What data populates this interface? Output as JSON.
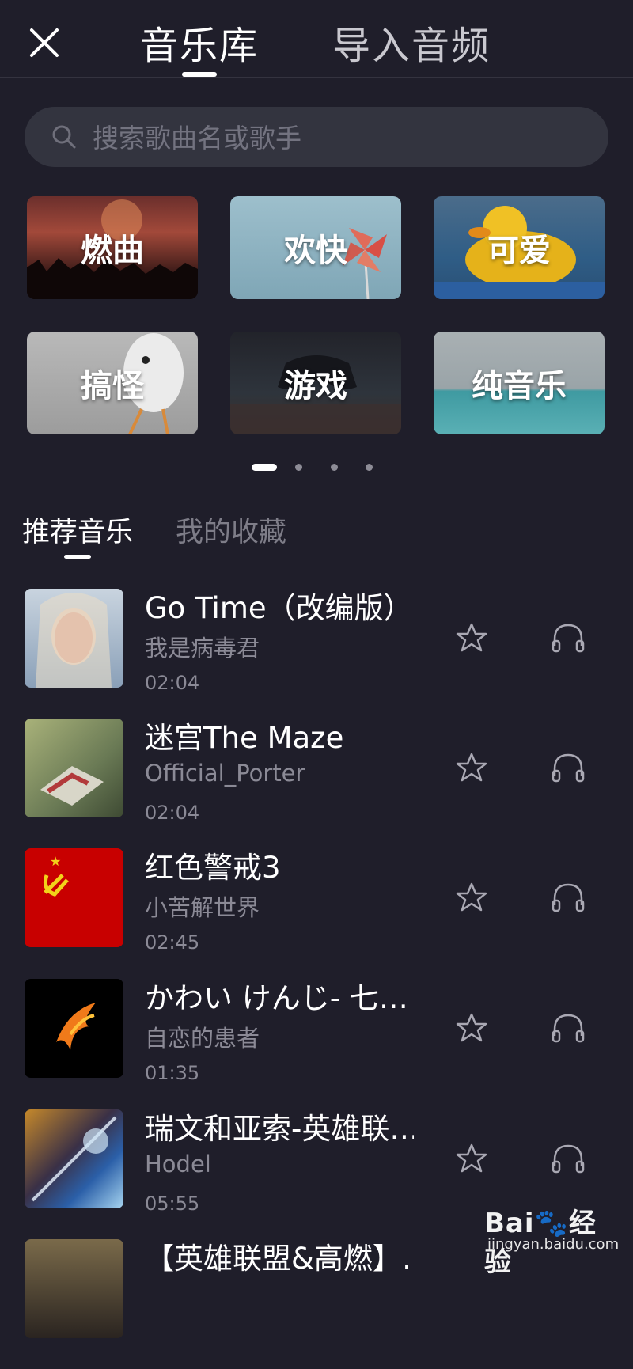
{
  "header": {
    "tabs": [
      {
        "label": "音乐库",
        "active": true
      },
      {
        "label": "导入音频",
        "active": false
      }
    ],
    "close_icon": "close-icon"
  },
  "search": {
    "placeholder": "搜索歌曲名或歌手",
    "value": "",
    "icon": "search-icon"
  },
  "categories": [
    {
      "label": "燃曲"
    },
    {
      "label": "欢快"
    },
    {
      "label": "可爱"
    },
    {
      "label": "搞怪"
    },
    {
      "label": "游戏"
    },
    {
      "label": "纯音乐"
    }
  ],
  "pager": {
    "pages": 4,
    "current": 1
  },
  "subtabs": [
    {
      "label": "推荐音乐",
      "active": true
    },
    {
      "label": "我的收藏",
      "active": false
    }
  ],
  "songs": [
    {
      "title": "Go Time（改编版）",
      "artist": "我是病毒君",
      "duration": "02:04"
    },
    {
      "title": "迷宫The Maze",
      "artist": "Official_Porter",
      "duration": "02:04"
    },
    {
      "title": "红色警戒3",
      "artist": "小苦解世界",
      "duration": "02:45"
    },
    {
      "title": "かわい けんじ- 七…",
      "artist": "自恋的患者",
      "duration": "01:35"
    },
    {
      "title": "瑞文和亚索-英雄联…",
      "artist": "Hodel",
      "duration": "05:55"
    },
    {
      "title": "【英雄联盟&高燃】…",
      "artist": "",
      "duration": ""
    }
  ],
  "watermark": {
    "brand": "Bai🐾经验",
    "url": "jingyan.baidu.com"
  },
  "colors": {
    "background": "#1f1e2a",
    "search_bg": "#33343f",
    "muted_text": "#8b8a96"
  }
}
